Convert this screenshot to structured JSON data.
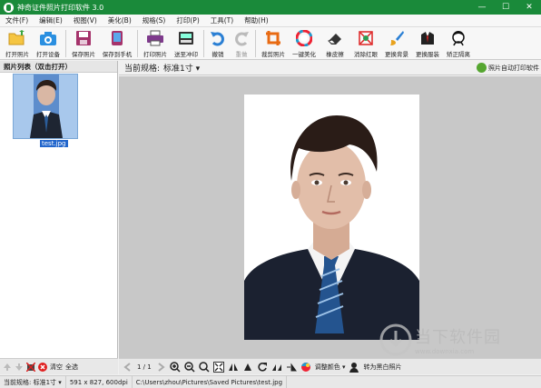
{
  "window": {
    "title": "神奇证件照片打印软件 3.0",
    "minimize": "—",
    "maximize": "☐",
    "close": "✕"
  },
  "menu": [
    "文件(F)",
    "编辑(E)",
    "视图(V)",
    "美化(B)",
    "规格(S)",
    "打印(P)",
    "工具(T)",
    "帮助(H)"
  ],
  "toolbar": {
    "open_photo": "打开照片",
    "open_device": "打开设备",
    "save_photo": "保存照片",
    "save_to_phone": "保存到手机",
    "print_photo": "打印照片",
    "send_print": "送至冲印",
    "undo": "撤销",
    "redo": "重做",
    "crop": "裁剪照片",
    "beautify": "一键美化",
    "eraser": "橡皮擦",
    "redeye": "消除红眼",
    "change_bg": "更换背景",
    "change_clothes": "更换服装",
    "fix_tilt": "矫正隔离"
  },
  "left_panel": {
    "header": "照片列表（双击打开）",
    "thumb_label": "test.jpg",
    "clear": "清空",
    "select_all": "全选"
  },
  "right_header": {
    "spec_label": "当前规格:",
    "spec_value": "标准1寸",
    "auto_print": "照片自动打印软件"
  },
  "bottom_bar": {
    "page": "1 / 1",
    "adjust_color": "调整颜色",
    "to_bw": "转为黑白照片"
  },
  "status": {
    "spec": "当前规格:",
    "spec_value": "标准1寸",
    "dims": "591 x 827, 600dpi",
    "path": "C:\\Users\\zhou\\Pictures\\Saved Pictures\\test.jpg"
  },
  "watermark": {
    "main": "当下软件园",
    "sub": "www.downxia.com"
  },
  "colors": {
    "titlebar": "#1a8a3a",
    "canvas": "#c8c8c8",
    "selection": "#2266cc"
  }
}
